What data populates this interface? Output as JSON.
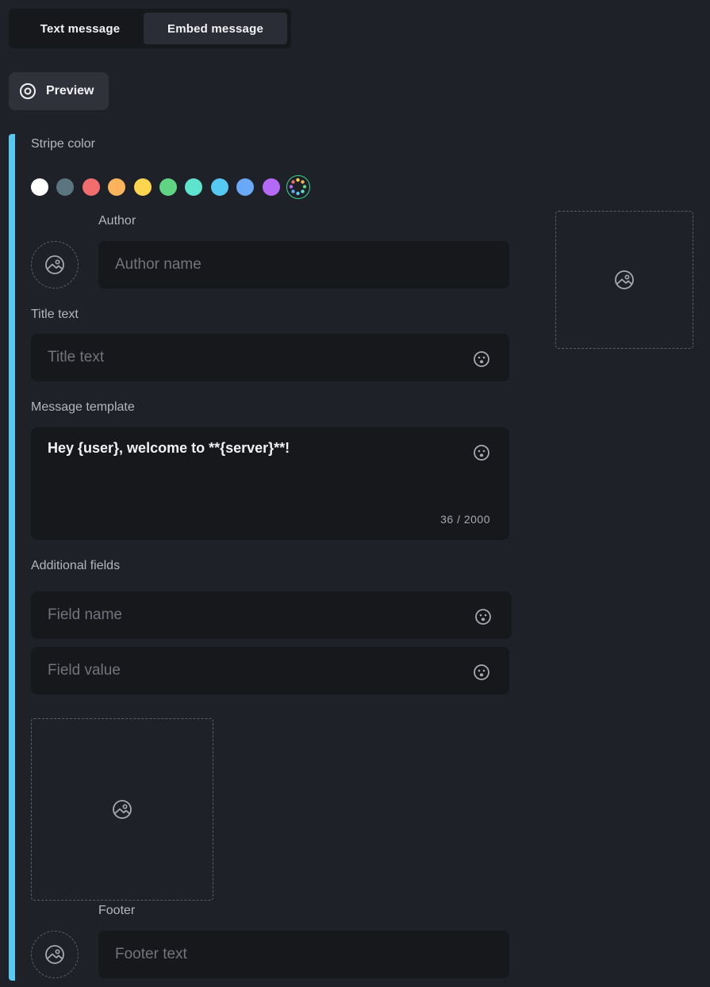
{
  "tabs": {
    "text_label": "Text message",
    "embed_label": "Embed message"
  },
  "preview": {
    "label": "Preview"
  },
  "stripe": {
    "label": "Stripe color",
    "active_color": "#55c9f2",
    "swatches": [
      "#ffffff",
      "#5a7580",
      "#f26d6d",
      "#fbb45c",
      "#fdd54e",
      "#5fd583",
      "#5ee3cf",
      "#55c9f2",
      "#6aa9f7",
      "#b46af7"
    ]
  },
  "author": {
    "label": "Author",
    "placeholder": "Author name"
  },
  "title": {
    "label": "Title text",
    "placeholder": "Title text"
  },
  "message": {
    "label": "Message template",
    "value": "Hey {user}, welcome to **{server}**!",
    "counter": "36 / 2000"
  },
  "fields": {
    "label": "Additional fields",
    "name_placeholder": "Field name",
    "value_placeholder": "Field value"
  },
  "footer": {
    "label": "Footer",
    "placeholder": "Footer text"
  }
}
